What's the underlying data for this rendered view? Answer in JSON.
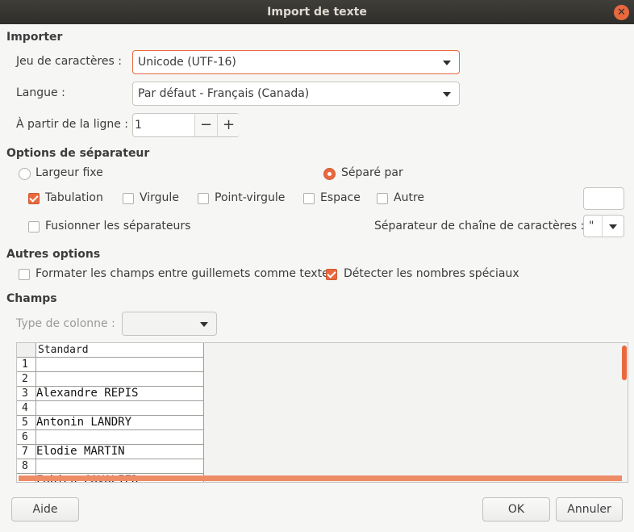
{
  "window": {
    "title": "Import de texte"
  },
  "importer": {
    "section": "Importer",
    "charset_label": "Jeu de caractères :",
    "charset_value": "Unicode (UTF-16)",
    "language_label": "Langue :",
    "language_value": "Par défaut - Français (Canada)",
    "from_row_label": "À partir de la ligne :",
    "from_row_value": "1",
    "minus": "−",
    "plus": "+"
  },
  "separator_options": {
    "section": "Options de séparateur",
    "fixed_width": "Largeur fixe",
    "separated_by": "Séparé par",
    "selected_mode": "separated_by",
    "tab": {
      "label": "Tabulation",
      "checked": true
    },
    "comma": {
      "label": "Virgule",
      "checked": false
    },
    "semicolon": {
      "label": "Point-virgule",
      "checked": false
    },
    "space": {
      "label": "Espace",
      "checked": false
    },
    "other": {
      "label": "Autre",
      "checked": false
    },
    "other_value": "",
    "merge": {
      "label": "Fusionner les séparateurs",
      "checked": false
    },
    "string_delimiter_label": "Séparateur de chaîne de caractères :",
    "string_delimiter_value": "\""
  },
  "other_options": {
    "section": "Autres options",
    "quoted_as_text": {
      "label": "Formater les champs entre guillemets comme texte",
      "checked": false
    },
    "detect_special_numbers": {
      "label": "Détecter les nombres spéciaux",
      "checked": true
    }
  },
  "fields": {
    "section": "Champs",
    "column_type_label": "Type de colonne :",
    "column_type_value": "",
    "column_header": "Standard",
    "rows": [
      {
        "num": "1",
        "value": ""
      },
      {
        "num": "2",
        "value": ""
      },
      {
        "num": "3",
        "value": "Alexandre REPIS"
      },
      {
        "num": "4",
        "value": ""
      },
      {
        "num": "5",
        "value": "Antonin LANDRY"
      },
      {
        "num": "6",
        "value": ""
      },
      {
        "num": "7",
        "value": "Elodie MARTIN"
      },
      {
        "num": "8",
        "value": ""
      },
      {
        "num": "",
        "value": "Fabien CAVALIER"
      }
    ]
  },
  "buttons": {
    "help": "Aide",
    "ok": "OK",
    "cancel": "Annuler"
  },
  "colors": {
    "accent": "#e9693f",
    "titlebar": "#3a3935"
  }
}
